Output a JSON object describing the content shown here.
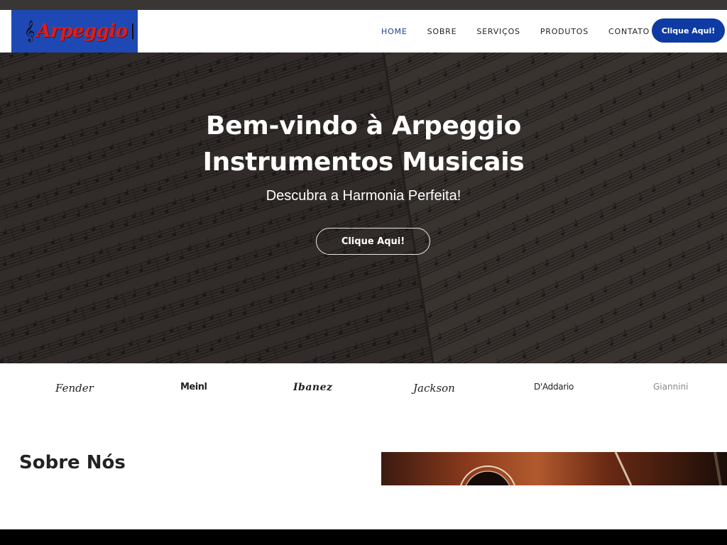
{
  "brand": {
    "logo_text": "Arpeggio",
    "logo_icon": "treble-clef-icon",
    "logo_bg_color": "#1e49b5",
    "logo_text_color": "#d62020"
  },
  "nav": {
    "items": [
      {
        "label": "HOME",
        "active": true
      },
      {
        "label": "SOBRE",
        "active": false
      },
      {
        "label": "SERVIÇOS",
        "active": false
      },
      {
        "label": "PRODUTOS",
        "active": false
      },
      {
        "label": "CONTATO",
        "active": false
      }
    ],
    "cta_label": "Clique Aqui!",
    "cta_color": "#0d3aa3",
    "active_color": "#1e3f8f"
  },
  "hero": {
    "title_line1": "Bem-vindo à Arpeggio",
    "title_line2": "Instrumentos Musicais",
    "subtitle": "Descubra a Harmonia Perfeita!",
    "button_label": "Clique Aqui!",
    "background": "sheet-music-image"
  },
  "brands": {
    "items": [
      {
        "name": "Fender"
      },
      {
        "name": "Meinl"
      },
      {
        "name": "Ibanez"
      },
      {
        "name": "Jackson"
      },
      {
        "name": "D'Addario"
      },
      {
        "name": "Giannini"
      }
    ]
  },
  "about": {
    "title": "Sobre Nós",
    "image": "acoustic-guitar-image"
  }
}
